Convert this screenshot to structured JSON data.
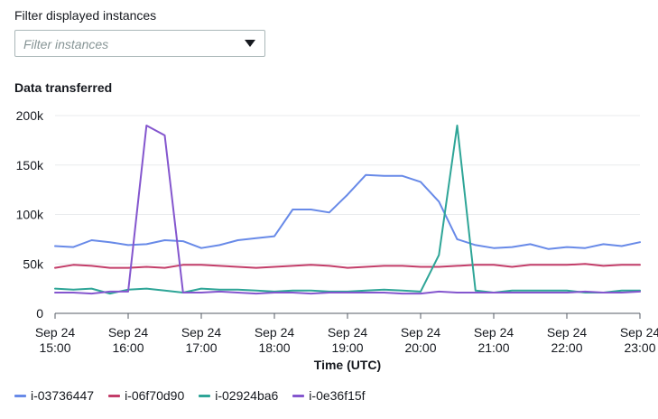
{
  "filter": {
    "label": "Filter displayed instances",
    "placeholder": "Filter instances"
  },
  "chart_data": {
    "type": "line",
    "title": "Data transferred",
    "xlabel": "Time (UTC)",
    "ylabel": "",
    "ylim": [
      0,
      200000
    ],
    "y_ticks": [
      "0",
      "50k",
      "100k",
      "150k",
      "200k"
    ],
    "x_tick_dates": [
      "Sep 24",
      "Sep 24",
      "Sep 24",
      "Sep 24",
      "Sep 24",
      "Sep 24",
      "Sep 24",
      "Sep 24",
      "Sep 24"
    ],
    "x_tick_times": [
      "15:00",
      "16:00",
      "17:00",
      "18:00",
      "19:00",
      "20:00",
      "21:00",
      "22:00",
      "23:00"
    ],
    "xlim": [
      "15:00",
      "23:00"
    ],
    "grid": true,
    "legend_position": "bottom",
    "x": [
      "15:00",
      "15:15",
      "15:30",
      "15:45",
      "16:00",
      "16:15",
      "16:30",
      "16:45",
      "17:00",
      "17:15",
      "17:30",
      "17:45",
      "18:00",
      "18:15",
      "18:30",
      "18:45",
      "19:00",
      "19:15",
      "19:30",
      "19:45",
      "20:00",
      "20:15",
      "20:30",
      "20:45",
      "21:00",
      "21:15",
      "21:30",
      "21:45",
      "22:00",
      "22:15",
      "22:30",
      "22:45",
      "23:00"
    ],
    "series": [
      {
        "name": "i-03736447",
        "color": "#688ae8",
        "values": [
          68000,
          67000,
          74000,
          72000,
          69000,
          70000,
          74000,
          73000,
          66000,
          69000,
          74000,
          76000,
          78000,
          105000,
          105000,
          102000,
          120000,
          140000,
          139000,
          139000,
          133000,
          113000,
          75000,
          69000,
          66000,
          67000,
          70000,
          65000,
          67000,
          66000,
          70000,
          68000,
          72000
        ]
      },
      {
        "name": "i-06f70d90",
        "color": "#c33d69",
        "values": [
          46000,
          49000,
          48000,
          46000,
          46000,
          47000,
          46000,
          49000,
          49000,
          48000,
          47000,
          46000,
          47000,
          48000,
          49000,
          48000,
          46000,
          47000,
          48000,
          48000,
          47000,
          47000,
          48000,
          49000,
          49000,
          47000,
          49000,
          49000,
          49000,
          50000,
          48000,
          49000,
          49000
        ]
      },
      {
        "name": "i-02924ba6",
        "color": "#2ea597",
        "values": [
          25000,
          24000,
          25000,
          20000,
          24000,
          25000,
          23000,
          21000,
          25000,
          24000,
          24000,
          23000,
          22000,
          23000,
          23000,
          22000,
          22000,
          23000,
          24000,
          23000,
          22000,
          59000,
          190000,
          23000,
          21000,
          23000,
          23000,
          23000,
          23000,
          21000,
          21000,
          23000,
          23000
        ]
      },
      {
        "name": "i-0e36f15f",
        "color": "#8456ce",
        "values": [
          21000,
          21000,
          20000,
          22000,
          22000,
          190000,
          180000,
          21000,
          21000,
          22000,
          21000,
          20000,
          21000,
          21000,
          20000,
          21000,
          21000,
          21000,
          21000,
          20000,
          20000,
          22000,
          21000,
          21000,
          21000,
          21000,
          21000,
          21000,
          21000,
          22000,
          21000,
          21000,
          22000
        ]
      }
    ]
  }
}
